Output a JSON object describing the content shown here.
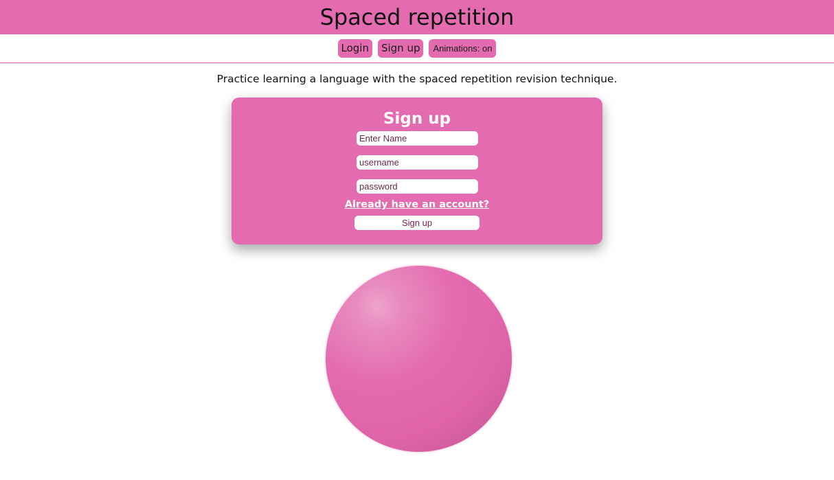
{
  "header": {
    "title": "Spaced repetition"
  },
  "nav": {
    "login_label": "Login",
    "signup_label": "Sign up",
    "animations_label": "Animations: on"
  },
  "main": {
    "tagline": "Practice learning a language with the spaced repetition revision technique."
  },
  "signup_form": {
    "title": "Sign up",
    "name_placeholder": "Enter Name",
    "username_placeholder": "username",
    "password_placeholder": "password",
    "account_link": "Already have an account?",
    "submit_label": "Sign up"
  },
  "colors": {
    "accent": "#e46baf",
    "text": "#111111",
    "card_text": "#ffffff"
  }
}
